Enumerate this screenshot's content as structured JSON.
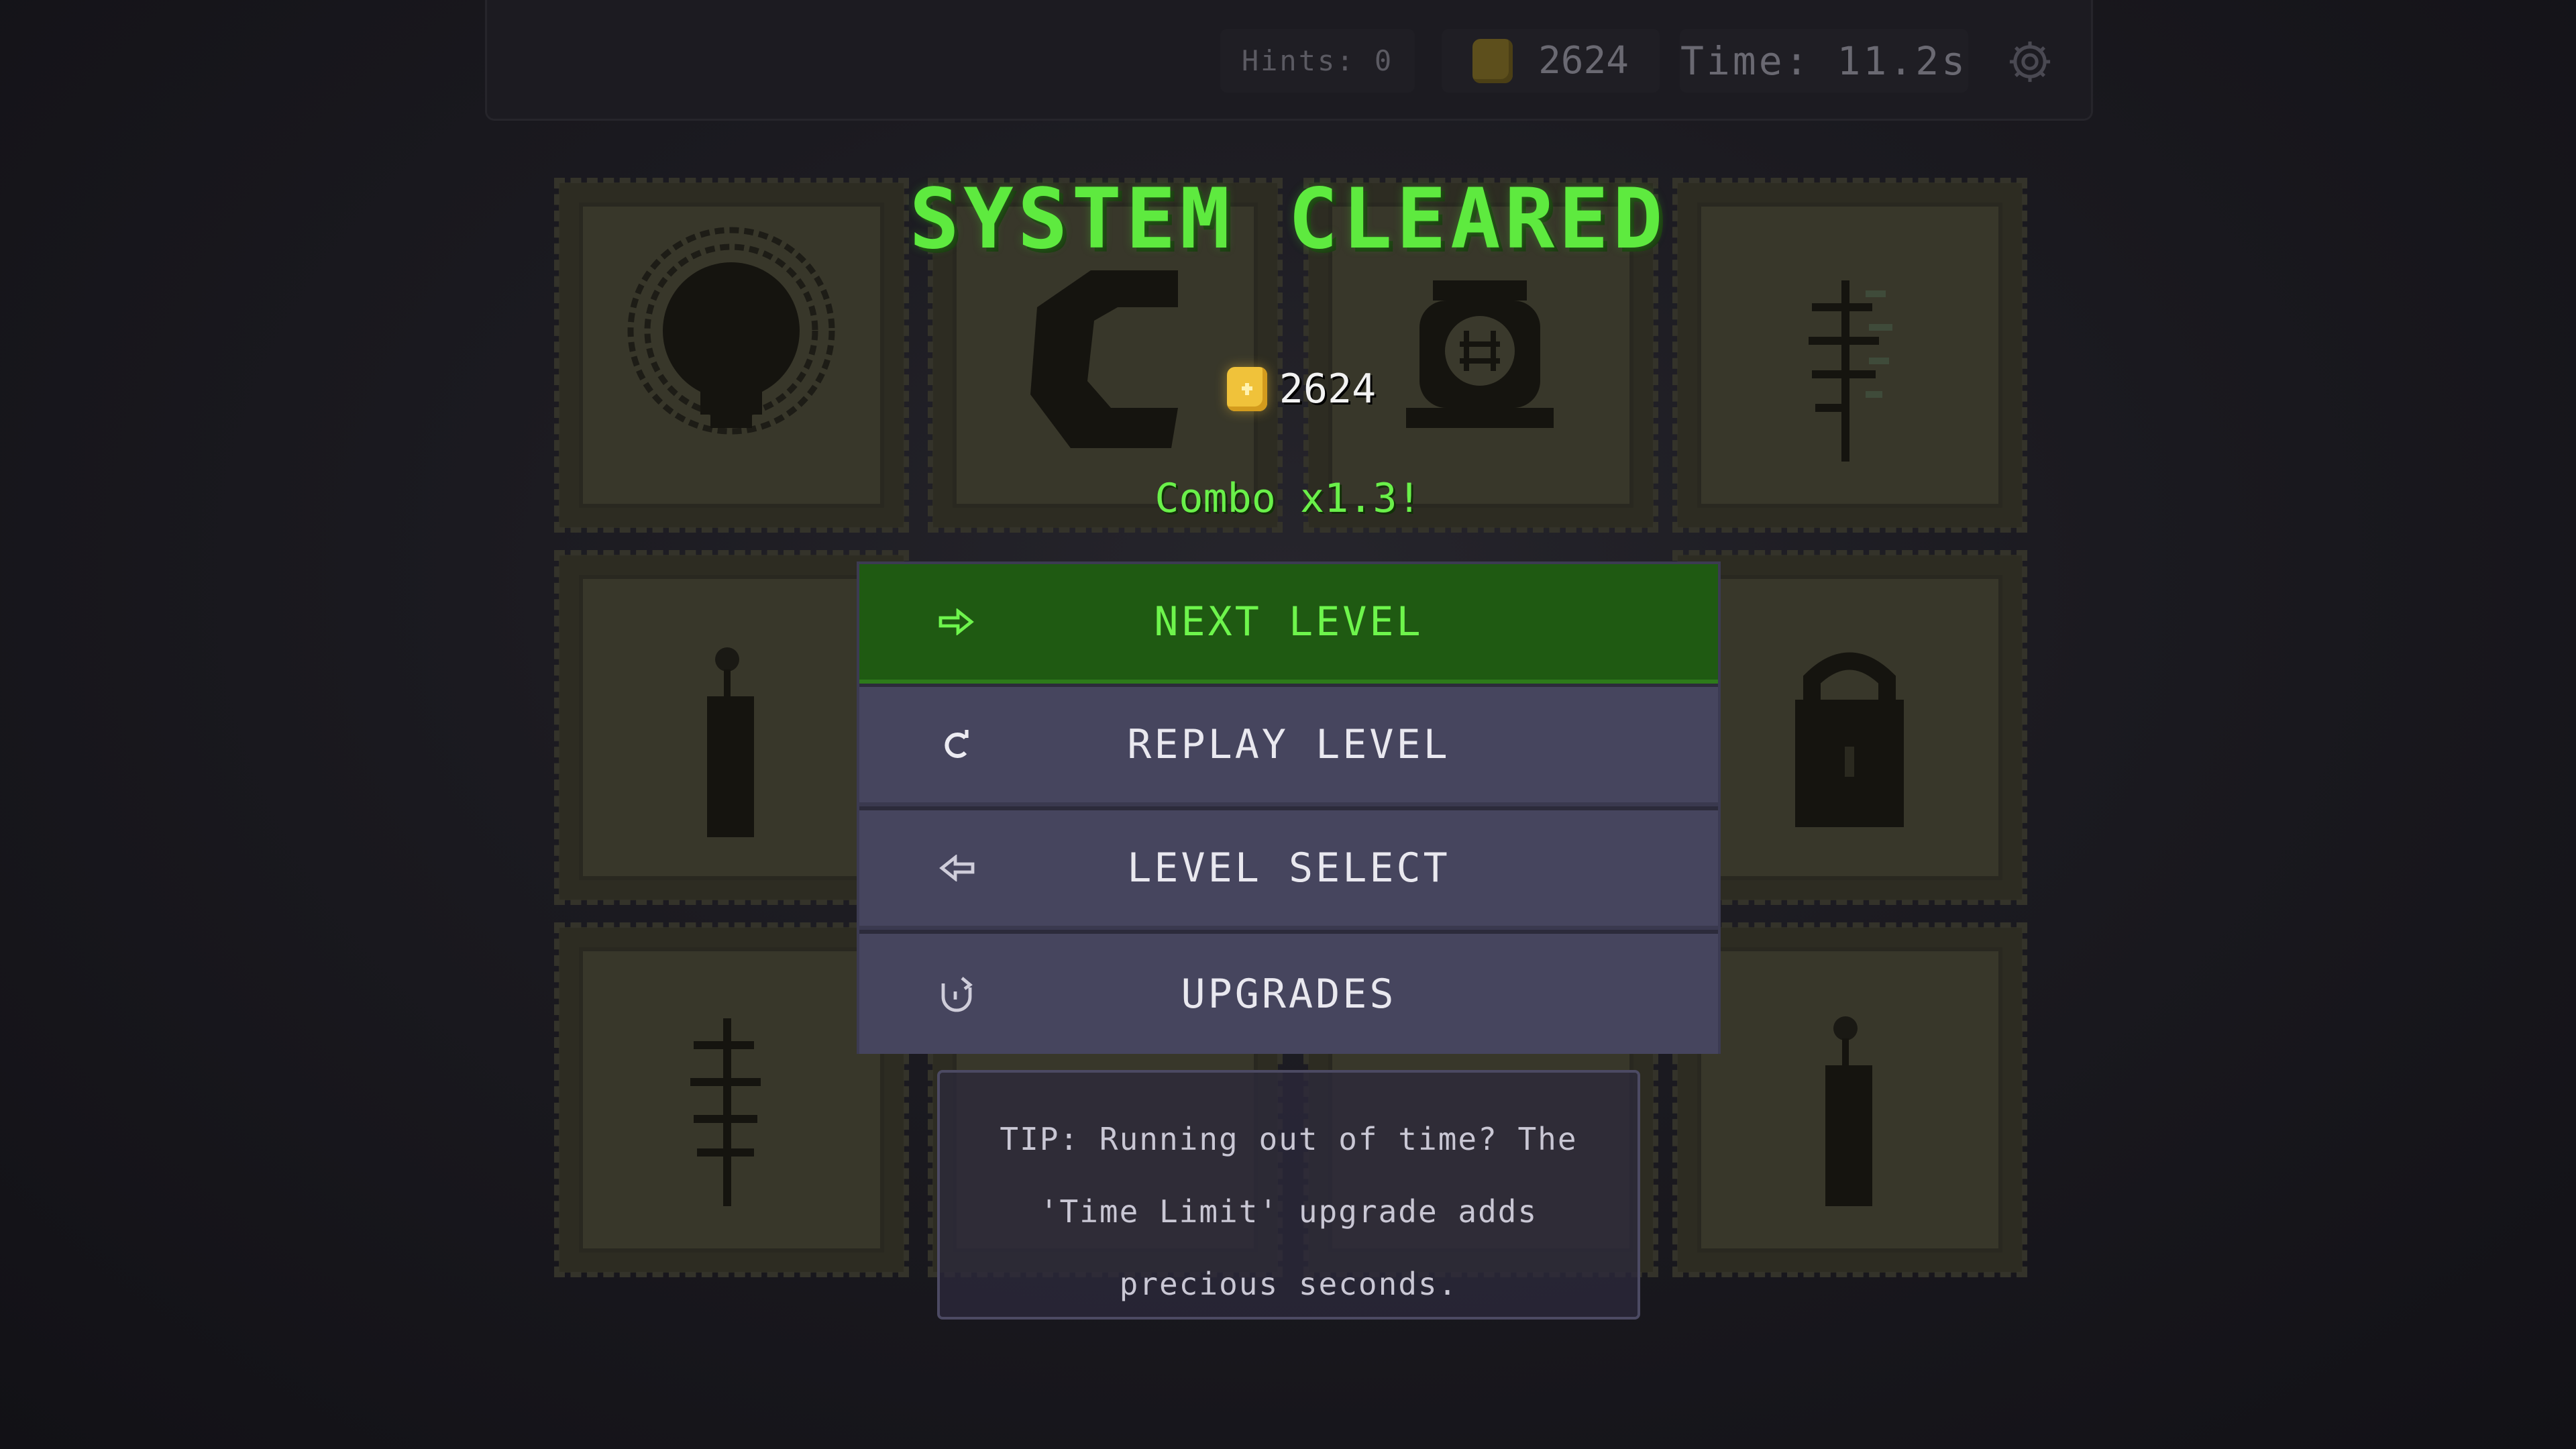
{
  "hud": {
    "hints_text": "Hints: 0",
    "coins": "2624",
    "time_text": "Time: 11.2s",
    "settings_icon": "gear-icon"
  },
  "tiles": [
    {
      "icon": "bulb-icon"
    },
    {
      "icon": "letter-c-icon"
    },
    {
      "icon": "lantern-icon"
    },
    {
      "icon": "plant-sprig-icon"
    },
    {
      "icon": "candle-icon"
    },
    {
      "icon": "padlock-icon"
    },
    {
      "icon": "plant-sprig-icon"
    },
    {
      "icon": "blank-tile"
    },
    {
      "icon": "blank-tile"
    },
    {
      "icon": "candle-icon"
    }
  ],
  "results": {
    "title": "SYSTEM CLEARED",
    "reward_coins": "2624",
    "combo_text": "Combo x1.3!"
  },
  "menu": {
    "next_label": "NEXT LEVEL",
    "next_icon": "arrow-right-icon",
    "replay_label": "REPLAY LEVEL",
    "replay_icon": "replay-icon",
    "select_label": "LEVEL SELECT",
    "select_icon": "arrow-left-icon",
    "upgrades_label": "UPGRADES",
    "upgrades_icon": "upgrade-icon"
  },
  "tip": {
    "line1": "TIP: Running out of time? The",
    "line2": "'Time Limit' upgrade adds",
    "line3": "precious seconds."
  },
  "colors": {
    "accent_green": "#5eea3f",
    "coin_gold": "#f0c23a",
    "menu_button": "#46455e",
    "next_button": "#1f5a12"
  }
}
